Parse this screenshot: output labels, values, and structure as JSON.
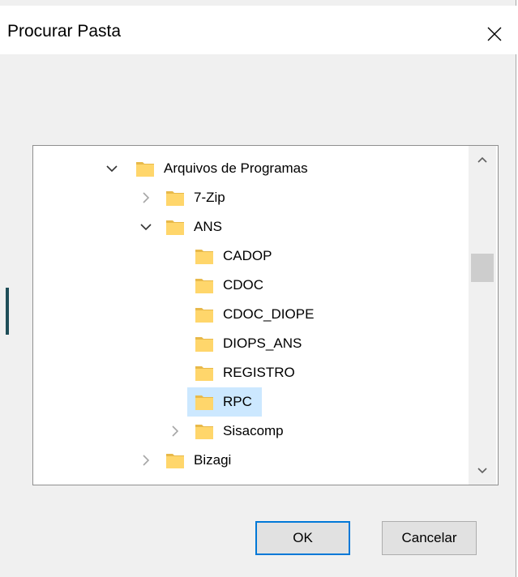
{
  "dialog": {
    "title": "Procurar Pasta"
  },
  "icons": {
    "close": "close-icon",
    "folder": "folder-icon",
    "expanded": "chevron-down-icon",
    "collapsed": "chevron-right-icon"
  },
  "tree": {
    "items": [
      {
        "label": "Arquivos de Programas",
        "level": 1,
        "state": "expanded"
      },
      {
        "label": "7-Zip",
        "level": 2,
        "state": "collapsed"
      },
      {
        "label": "ANS",
        "level": 2,
        "state": "expanded"
      },
      {
        "label": "CADOP",
        "level": 3,
        "state": "none"
      },
      {
        "label": "CDOC",
        "level": 3,
        "state": "none"
      },
      {
        "label": "CDOC_DIOPE",
        "level": 3,
        "state": "none"
      },
      {
        "label": "DIOPS_ANS",
        "level": 3,
        "state": "none"
      },
      {
        "label": "REGISTRO",
        "level": 3,
        "state": "none"
      },
      {
        "label": "RPC",
        "level": 3,
        "state": "none",
        "selected": true
      },
      {
        "label": "Sisacomp",
        "level": 3,
        "state": "collapsed"
      },
      {
        "label": "Bizagi",
        "level": 2,
        "state": "collapsed"
      }
    ]
  },
  "buttons": {
    "ok": "OK",
    "cancel": "Cancelar"
  },
  "colors": {
    "selection": "#cce8ff",
    "folder": "#ffd66b",
    "accent": "#0078d7"
  }
}
